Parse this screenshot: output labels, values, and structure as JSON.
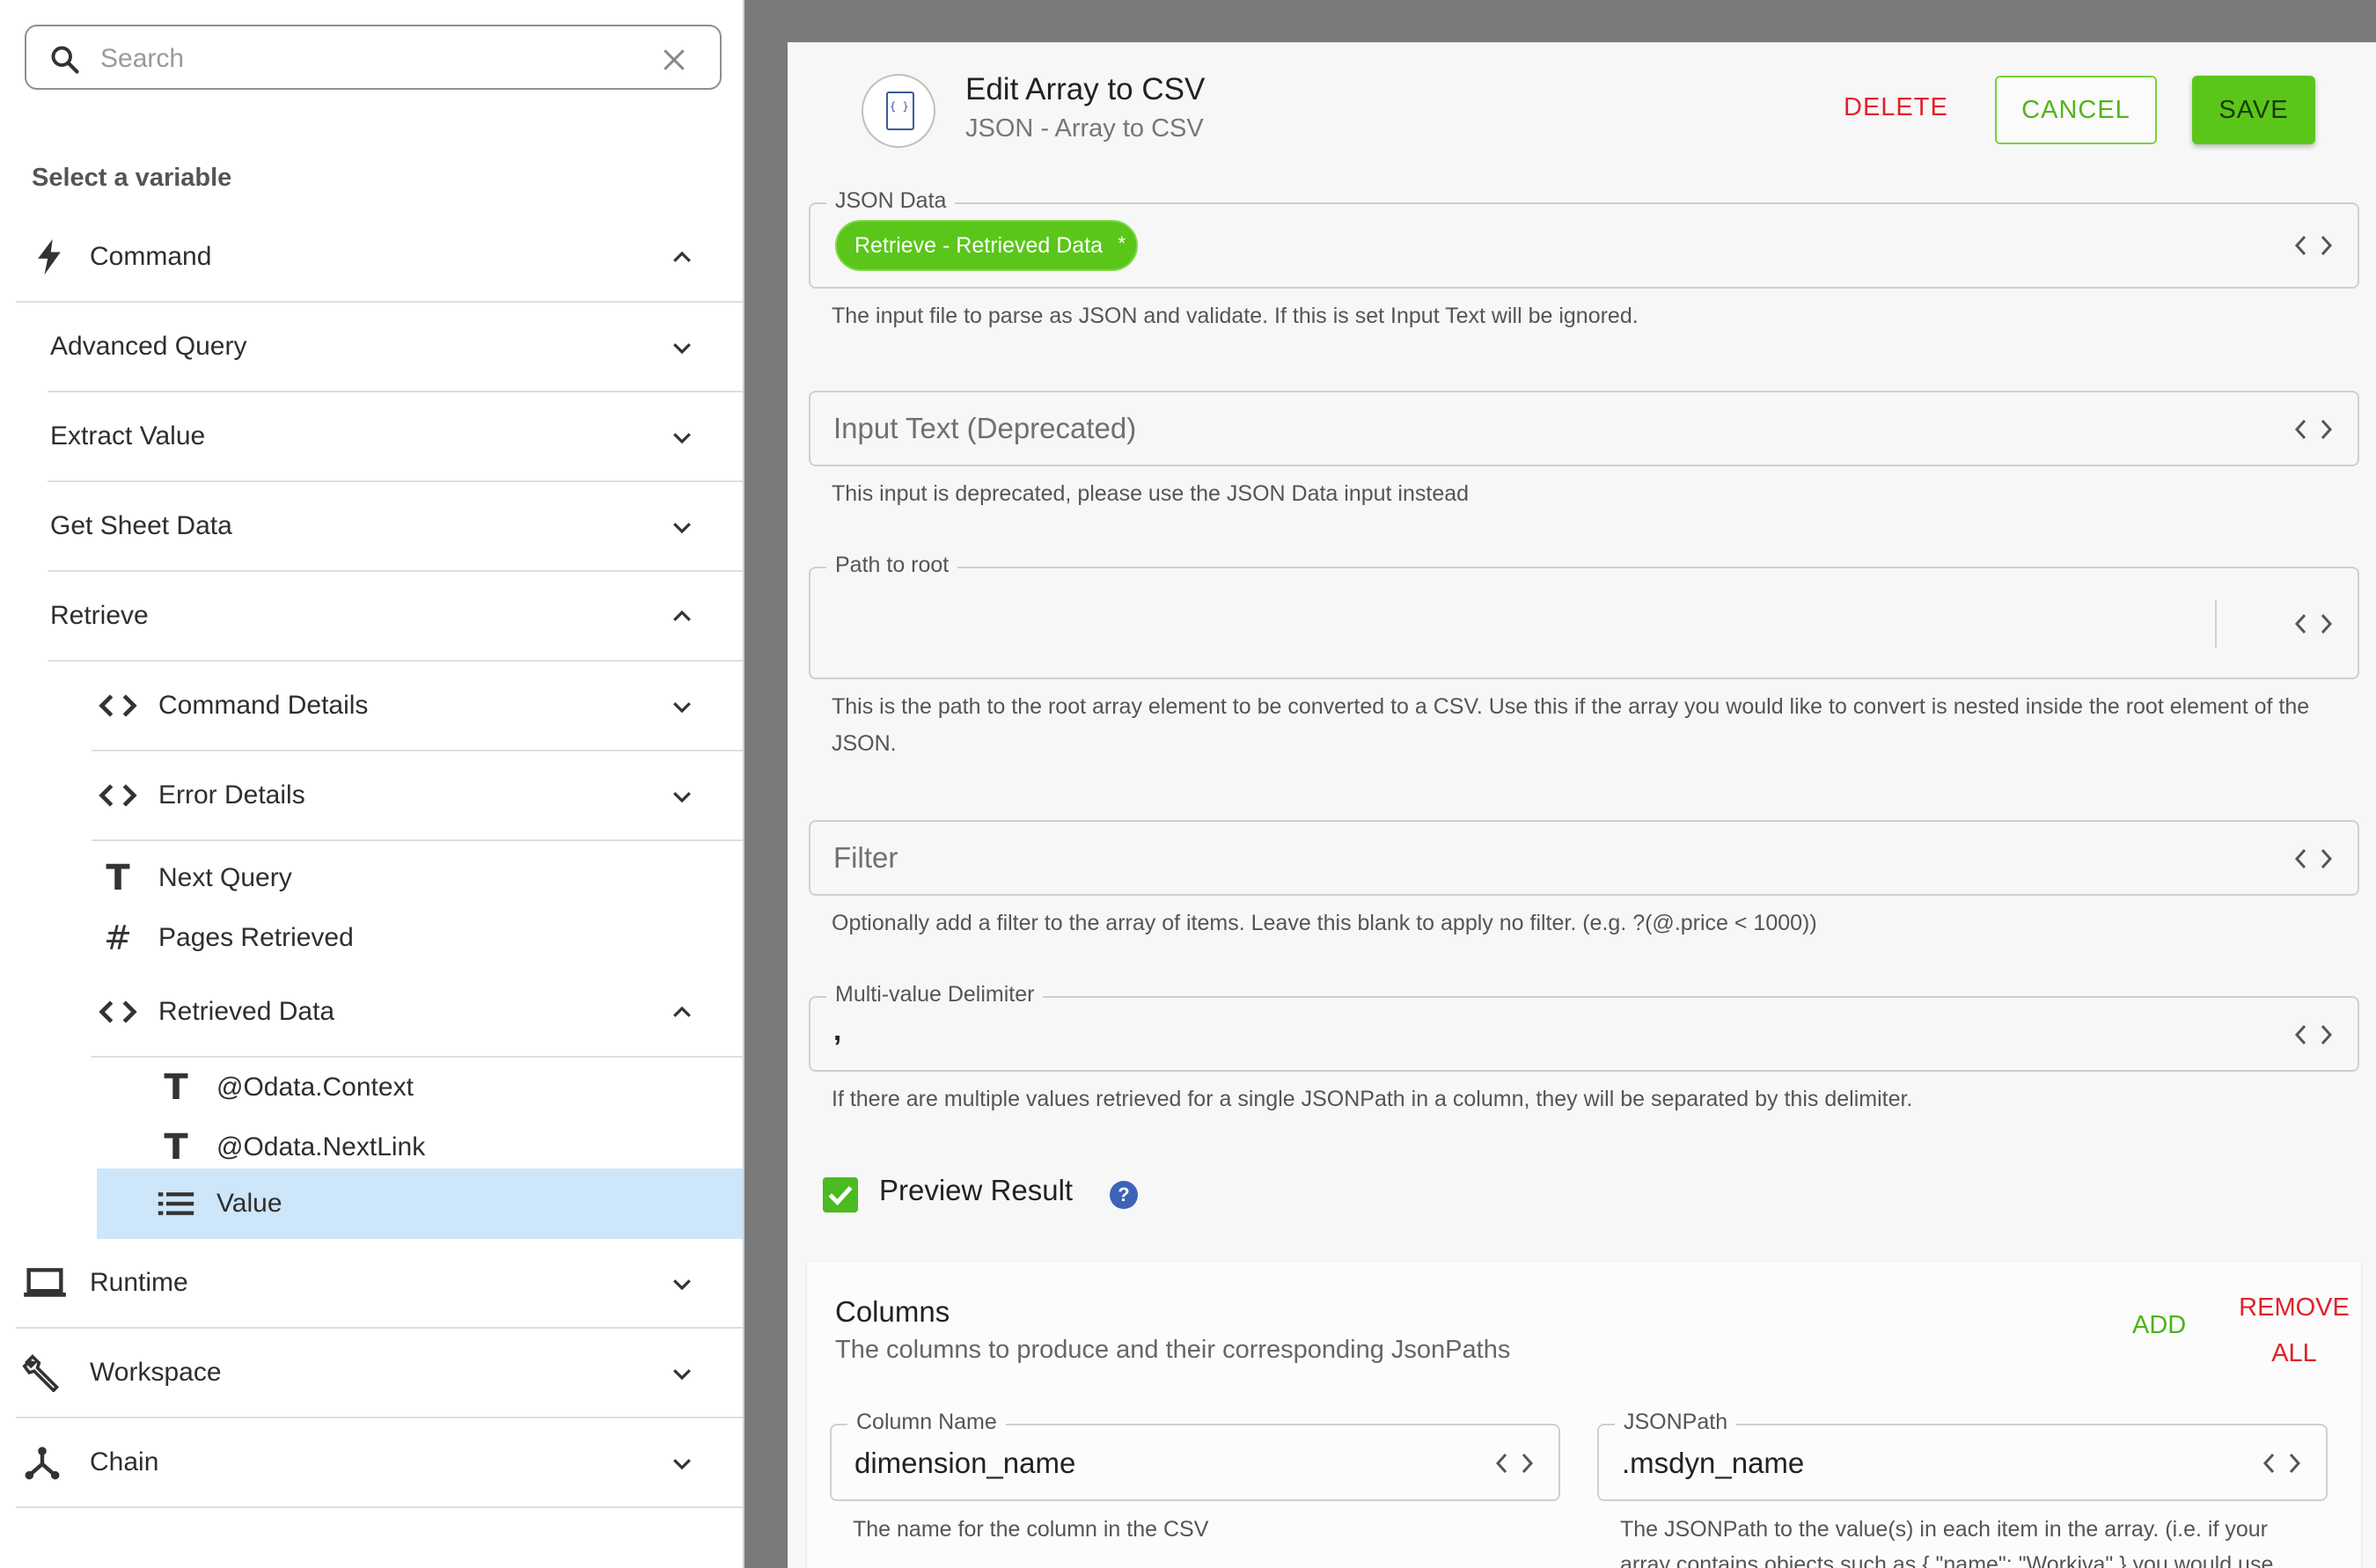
{
  "sidebar": {
    "search_placeholder": "Search",
    "title": "Select a variable",
    "items": [
      {
        "label": "Command"
      },
      {
        "label": "Advanced Query"
      },
      {
        "label": "Extract Value"
      },
      {
        "label": "Get Sheet Data"
      },
      {
        "label": "Retrieve"
      },
      {
        "label": "Command Details"
      },
      {
        "label": "Error Details"
      },
      {
        "label": "Next Query"
      },
      {
        "label": "Pages Retrieved"
      },
      {
        "label": "Retrieved Data"
      },
      {
        "label": "@Odata.Context"
      },
      {
        "label": "@Odata.NextLink"
      },
      {
        "label": "Value"
      },
      {
        "label": "Runtime"
      },
      {
        "label": "Workspace"
      },
      {
        "label": "Chain"
      }
    ]
  },
  "dialog": {
    "title": "Edit Array to CSV",
    "subtitle": "JSON - Array to CSV",
    "icon_text": "{ }",
    "delete_label": "DELETE",
    "cancel_label": "CANCEL",
    "save_label": "SAVE",
    "json_data": {
      "label": "JSON Data",
      "chip": "Retrieve - Retrieved Data",
      "chip_mark": "*",
      "help": "The input file to parse as JSON and validate. If this is set Input Text will be ignored."
    },
    "input_text": {
      "placeholder": "Input Text (Deprecated)",
      "help": "This input is deprecated, please use the JSON Data input instead"
    },
    "path_to_root": {
      "label": "Path to root",
      "help": "This is the path to the root array element to be converted to a CSV. Use this if the array you would like to convert is nested inside the root element of the JSON."
    },
    "filter": {
      "placeholder": "Filter",
      "help": "Optionally add a filter to the array of items. Leave this blank to apply no filter. (e.g. ?(@.price < 1000))"
    },
    "delimiter": {
      "label": "Multi-value Delimiter",
      "value": ",",
      "help": "If there are multiple values retrieved for a single JSONPath in a column, they will be separated by this delimiter."
    },
    "preview": {
      "label": "Preview Result",
      "checked": true,
      "help_icon": "?"
    },
    "columns": {
      "title": "Columns",
      "subtitle": "The columns to produce and their corresponding JsonPaths",
      "add_label": "ADD",
      "remove_line1": "REMOVE",
      "remove_line2": "ALL",
      "column_name": {
        "label": "Column Name",
        "value": "dimension_name",
        "help": "The name for the column in the CSV"
      },
      "json_path": {
        "label": "JSONPath",
        "value": ".msdyn_name",
        "help": "The JSONPath to the value(s) in each item in the array. (i.e. if your array contains objects such as { \"name\": \"Workiva\" } you would use"
      }
    }
  },
  "colors": {
    "accent_green": "#5ac61a",
    "danger_red": "#e0222a",
    "selected_row": "#cde6fa",
    "help_blue": "#3d63b8"
  }
}
